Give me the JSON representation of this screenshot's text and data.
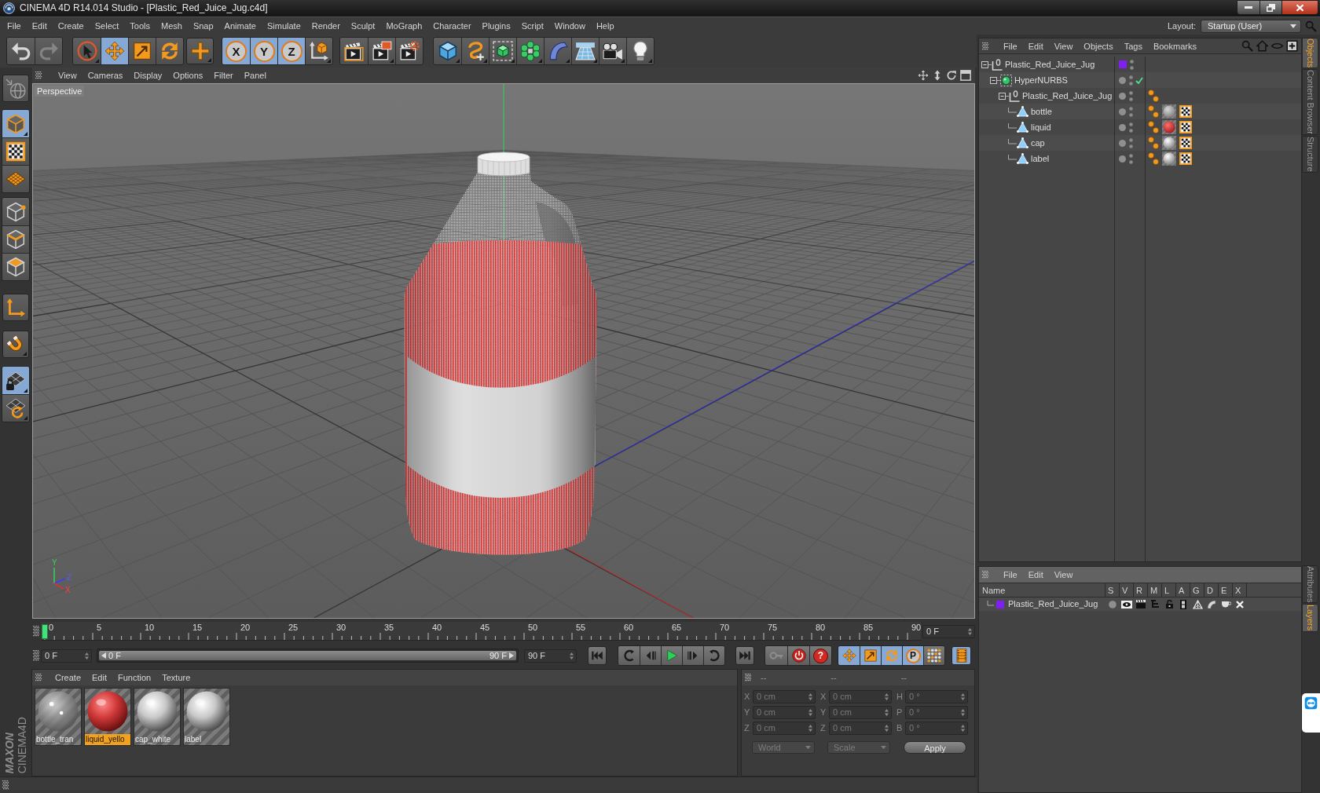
{
  "window": {
    "title": "CINEMA 4D R14.014 Studio - [Plastic_Red_Juice_Jug.c4d]"
  },
  "menu_bar": [
    "File",
    "Edit",
    "Create",
    "Select",
    "Tools",
    "Mesh",
    "Snap",
    "Animate",
    "Simulate",
    "Render",
    "Sculpt",
    "MoGraph",
    "Character",
    "Plugins",
    "Script",
    "Window",
    "Help"
  ],
  "layout": {
    "label": "Layout:",
    "value": "Startup (User)"
  },
  "toolbar": [
    {
      "buttons": [
        {
          "kind": "undo",
          "disabled": false
        },
        {
          "kind": "redo",
          "disabled": true
        }
      ]
    },
    {
      "buttons": [
        {
          "kind": "select",
          "selected": false
        },
        {
          "kind": "move",
          "selected": true
        },
        {
          "kind": "scale",
          "selected": false
        },
        {
          "kind": "rotate",
          "selected": false
        }
      ]
    },
    {
      "buttons": [
        {
          "kind": "recent",
          "selected": false
        }
      ]
    },
    {
      "buttons": [
        {
          "kind": "axis",
          "label": "X",
          "selected": true
        },
        {
          "kind": "axis",
          "label": "Y",
          "selected": true
        },
        {
          "kind": "axis",
          "label": "Z",
          "selected": true
        },
        {
          "kind": "coords",
          "selected": false
        }
      ]
    },
    {
      "buttons": [
        {
          "kind": "render_view"
        },
        {
          "kind": "render_viewer"
        },
        {
          "kind": "render_settings"
        }
      ]
    },
    {
      "buttons": [
        {
          "kind": "cube"
        },
        {
          "kind": "spline"
        },
        {
          "kind": "nurbs"
        },
        {
          "kind": "cloner"
        },
        {
          "kind": "deformer"
        },
        {
          "kind": "floor"
        },
        {
          "kind": "camera"
        },
        {
          "kind": "light"
        }
      ]
    }
  ],
  "mode_toolbar": [
    {
      "buttons": [
        {
          "kind": "make_editable",
          "selected": false
        }
      ]
    },
    {
      "buttons": [
        {
          "kind": "model",
          "selected": true
        },
        {
          "kind": "texture",
          "selected": false
        },
        {
          "kind": "workplane",
          "selected": false
        }
      ]
    },
    {
      "buttons": [
        {
          "kind": "points",
          "selected": false
        },
        {
          "kind": "edges",
          "selected": false
        },
        {
          "kind": "polygons",
          "selected": false
        }
      ]
    },
    {
      "buttons": [
        {
          "kind": "axis_mode",
          "selected": false
        }
      ]
    },
    {
      "buttons": [
        {
          "kind": "snap",
          "selected": false
        }
      ]
    },
    {
      "buttons": [
        {
          "kind": "lock_workplane",
          "selected": true
        },
        {
          "kind": "align_workplane",
          "selected": false
        }
      ]
    }
  ],
  "viewport": {
    "menu": [
      "View",
      "Cameras",
      "Display",
      "Options",
      "Filter",
      "Panel"
    ],
    "camera": "Perspective",
    "gizmo_labels": [
      "Y",
      "Z",
      "X"
    ]
  },
  "timeline": {
    "ticks": [
      "0",
      "5",
      "10",
      "15",
      "20",
      "25",
      "30",
      "35",
      "40",
      "45",
      "50",
      "55",
      "60",
      "65",
      "70",
      "75",
      "80",
      "85",
      "90"
    ],
    "playhead": {
      "level": 0
    },
    "current_frame": "0 F",
    "start_frame": "0 F",
    "range": {
      "start": "0 F",
      "end": "90 F",
      "level": 1
    },
    "end_frame": "90 F",
    "controls": [
      {
        "buttons": [
          {
            "kind": "go_start"
          }
        ]
      },
      {
        "buttons": [
          {
            "kind": "prev_key"
          },
          {
            "kind": "step_back"
          },
          {
            "kind": "play"
          },
          {
            "kind": "step_forward"
          },
          {
            "kind": "next_key"
          }
        ]
      },
      {
        "buttons": [
          {
            "kind": "go_end"
          }
        ]
      },
      {
        "buttons": [
          {
            "kind": "record"
          },
          {
            "kind": "autokey"
          },
          {
            "kind": "keyframe_selection",
            "label": "?"
          }
        ]
      },
      {
        "buttons": [
          {
            "kind": "track_position",
            "selected": true
          },
          {
            "kind": "track_scale",
            "selected": true
          },
          {
            "kind": "track_rotation",
            "selected": true
          },
          {
            "kind": "track_parameter",
            "label": "P",
            "selected": true
          },
          {
            "kind": "track_points",
            "selected": false
          }
        ]
      },
      {
        "buttons": [
          {
            "kind": "timeline_window",
            "selected": true
          }
        ]
      }
    ]
  },
  "materials": {
    "menu": [
      "Create",
      "Edit",
      "Function",
      "Texture"
    ],
    "items": [
      {
        "name": "bottle_tran",
        "kind": "glass",
        "selected": false
      },
      {
        "name": "liquid_yello",
        "kind": "red",
        "selected": true
      },
      {
        "name": "cap_white",
        "kind": "white",
        "selected": false
      },
      {
        "name": "label",
        "kind": "white",
        "selected": false
      }
    ]
  },
  "coordinates": {
    "headers": [
      "--",
      "--",
      "--"
    ],
    "disabled": true,
    "rows": [
      [
        {
          "axis": "X",
          "value": "0 cm"
        },
        {
          "axis": "X",
          "value": "0 cm"
        },
        {
          "axis": "H",
          "value": "0 °"
        }
      ],
      [
        {
          "axis": "Y",
          "value": "0 cm"
        },
        {
          "axis": "Y",
          "value": "0 cm"
        },
        {
          "axis": "P",
          "value": "0 °"
        }
      ],
      [
        {
          "axis": "Z",
          "value": "0 cm"
        },
        {
          "axis": "Z",
          "value": "0 cm"
        },
        {
          "axis": "B",
          "value": "0 °"
        }
      ]
    ],
    "dropdowns": [
      "World",
      "Scale"
    ],
    "apply": "Apply"
  },
  "object_manager": {
    "menu": [
      "File",
      "Edit",
      "View",
      "Objects",
      "Tags",
      "Bookmarks"
    ],
    "tree": [
      {
        "name": "Plastic_Red_Juice_Jug",
        "kind": "null",
        "color": "#7f1ff2",
        "expanded": true,
        "children": [
          {
            "name": "HyperNURBS",
            "kind": "hypernurbs",
            "enabled": true,
            "expanded": true,
            "children": [
              {
                "name": "Plastic_Red_Juice_Jug",
                "kind": "null",
                "expanded": true,
                "tags": [
                  {
                    "kind": "phong"
                  }
                ],
                "children": [
                  {
                    "name": "bottle",
                    "kind": "polygon",
                    "tags": [
                      {
                        "kind": "phong"
                      },
                      {
                        "kind": "glass_material"
                      },
                      {
                        "kind": "uvw"
                      }
                    ]
                  },
                  {
                    "name": "liquid",
                    "kind": "polygon",
                    "tags": [
                      {
                        "kind": "phong"
                      },
                      {
                        "kind": "red_material"
                      },
                      {
                        "kind": "uvw"
                      }
                    ]
                  },
                  {
                    "name": "cap",
                    "kind": "polygon",
                    "tags": [
                      {
                        "kind": "phong"
                      },
                      {
                        "kind": "white_material"
                      },
                      {
                        "kind": "uvw"
                      }
                    ]
                  },
                  {
                    "name": "label",
                    "kind": "polygon",
                    "tags": [
                      {
                        "kind": "phong"
                      },
                      {
                        "kind": "white_material"
                      },
                      {
                        "kind": "uvw"
                      }
                    ]
                  }
                ]
              }
            ]
          }
        ]
      }
    ]
  },
  "layer_manager": {
    "menu": [
      "File",
      "Edit",
      "View"
    ],
    "columns": [
      "Name",
      "S",
      "V",
      "R",
      "M",
      "L",
      "A",
      "G",
      "D",
      "E",
      "X"
    ],
    "rows": [
      {
        "name": "Plastic_Red_Juice_Jug",
        "color": "#7f1ff2"
      }
    ]
  },
  "side_tabs": {
    "top": [
      {
        "label": "Objects",
        "selected": true
      },
      {
        "label": "Content Browser",
        "selected": false
      },
      {
        "label": "Structure",
        "selected": false
      }
    ],
    "bottom": [
      {
        "label": "Attributes",
        "selected": false
      },
      {
        "label": "Layers",
        "selected": true
      }
    ]
  },
  "logo": {
    "brand": "MAXON",
    "product": "CINEMA4D"
  }
}
